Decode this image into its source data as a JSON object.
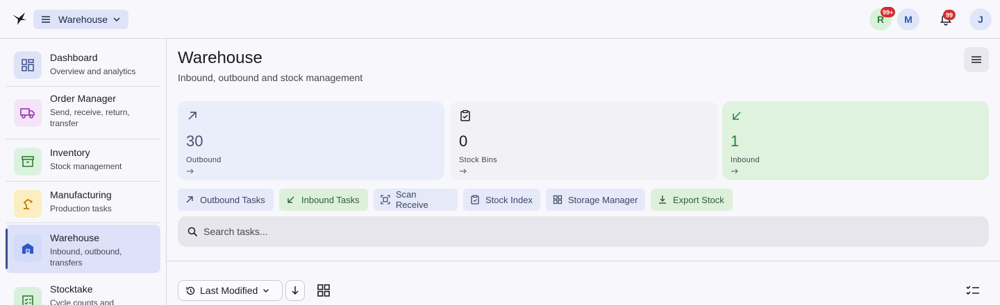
{
  "header": {
    "workspace_label": "Warehouse",
    "avatars": [
      {
        "initial": "R",
        "badge": "99+"
      },
      {
        "initial": "M"
      },
      {
        "initial": "J"
      }
    ],
    "notifications_badge": "99"
  },
  "sidebar": {
    "items": [
      {
        "title": "Dashboard",
        "subtitle": "Overview and analytics",
        "icon": "dashboard-icon",
        "color": "#dfe3f7"
      },
      {
        "title": "Order Manager",
        "subtitle": "Send, receive, return, transfer",
        "icon": "truck-icon",
        "color": "#f3e4f7"
      },
      {
        "title": "Inventory",
        "subtitle": "Stock management",
        "icon": "archive-icon",
        "color": "#dbf2df"
      },
      {
        "title": "Manufacturing",
        "subtitle": "Production tasks",
        "icon": "robot-arm-icon",
        "color": "#fbeec0"
      },
      {
        "title": "Warehouse",
        "subtitle": "Inbound, outbound, transfers",
        "icon": "warehouse-icon",
        "color": "#d2dbf7",
        "active": true
      },
      {
        "title": "Stocktake",
        "subtitle": "Cycle counts and",
        "icon": "checklist-icon",
        "color": "#d9f0dc"
      }
    ]
  },
  "page": {
    "title": "Warehouse",
    "subtitle": "Inbound, outbound and stock management"
  },
  "stats": [
    {
      "value": "30",
      "label": "Outbound",
      "icon": "arrow-up-right-icon"
    },
    {
      "value": "0",
      "label": "Stock Bins",
      "icon": "clipboard-check-icon"
    },
    {
      "value": "1",
      "label": "Inbound",
      "icon": "arrow-down-left-icon"
    }
  ],
  "actions": [
    {
      "label": "Outbound Tasks",
      "icon": "arrow-up-right-icon"
    },
    {
      "label": "Inbound Tasks",
      "icon": "arrow-down-left-icon"
    },
    {
      "label": "Scan Receive",
      "icon": "scan-icon"
    },
    {
      "label": "Stock Index",
      "icon": "clipboard-icon"
    },
    {
      "label": "Storage Manager",
      "icon": "grid-icon"
    },
    {
      "label": "Export Stock",
      "icon": "download-icon"
    }
  ],
  "search": {
    "placeholder": "Search tasks..."
  },
  "sort": {
    "label": "Last Modified"
  },
  "colors": {
    "accent": "#3a4e8a",
    "badge": "#d32f2f",
    "inbound_green": "#2e7d32"
  }
}
